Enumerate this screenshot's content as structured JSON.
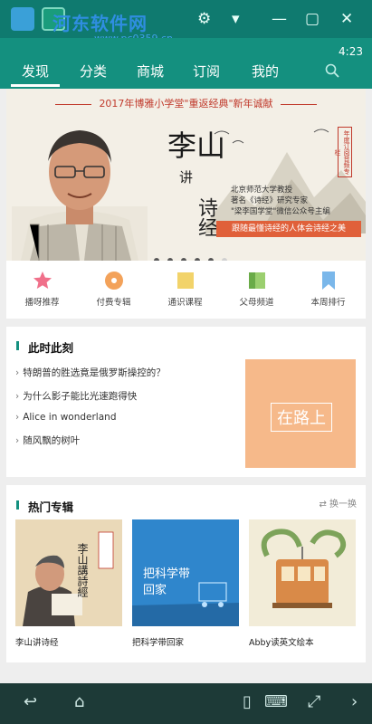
{
  "titlebar": {
    "watermark": "河东软件网",
    "watermark_url": "www.pc0359.cn",
    "controls": [
      "settings-icon",
      "dropdown-icon",
      "minimize-icon",
      "maximize-icon",
      "close-icon"
    ]
  },
  "status": {
    "time": "4:23"
  },
  "nav": {
    "tabs": [
      {
        "label": "发现",
        "active": true
      },
      {
        "label": "分类",
        "active": false
      },
      {
        "label": "商城",
        "active": false
      },
      {
        "label": "订阅",
        "active": false
      },
      {
        "label": "我的",
        "active": false
      }
    ],
    "search_icon": "search-icon"
  },
  "banner": {
    "headline": "2017年博雅小学堂\"重返经典\"新年诚献",
    "name": "李山",
    "verb": "讲",
    "subject": "诗经",
    "bio": [
      "北京师范大学教授",
      "著名《诗经》研究专家",
      "\"梁李国学堂\"微信公众号主编"
    ],
    "stamp": "年度订阅音频专栏",
    "slogan": "跟随最懂诗经的人体会诗经之美",
    "dots_count": 6,
    "active_dot": 5
  },
  "categories": [
    {
      "label": "播呀推荐",
      "icon": "star-icon",
      "color": "#f0708a"
    },
    {
      "label": "付费专辑",
      "icon": "disc-icon",
      "color": "#f3a25a"
    },
    {
      "label": "通识课程",
      "icon": "note-icon",
      "color": "#f2d36a"
    },
    {
      "label": "父母频道",
      "icon": "book-icon",
      "color": "#9bcf6f"
    },
    {
      "label": "本周排行",
      "icon": "bookmark-icon",
      "color": "#7ab7ea"
    }
  ],
  "moment": {
    "title": "此时此刻",
    "items": [
      "特朗普的胜选竟是俄罗斯操控的？",
      "为什么影子能比光速跑得快",
      "Alice in wonderland",
      "随风飘的树叶"
    ],
    "feature_label": "在路上",
    "feature_color": "#f6b98a"
  },
  "hot": {
    "title": "热门专辑",
    "refresh": "换一换",
    "albums": [
      {
        "title": "李山讲诗经",
        "cover_text": "李山講詩經"
      },
      {
        "title": "把科学带回家",
        "cover_text": "把科学带回家"
      },
      {
        "title": "Abby读英文绘本",
        "cover_text": ""
      }
    ]
  },
  "bottom": {
    "icons": [
      "back-icon",
      "home-icon",
      "phone-icon",
      "keyboard-icon",
      "fullscreen-icon",
      "next-icon"
    ]
  },
  "colors": {
    "primary": "#14907f",
    "titlebar": "#0f7a6f",
    "bottombar": "#1d3a37"
  }
}
